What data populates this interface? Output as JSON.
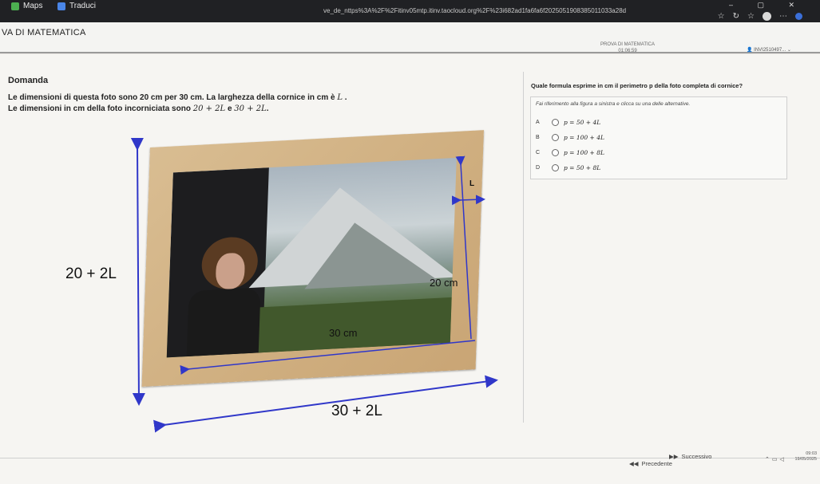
{
  "browser": {
    "bookmarks": [
      {
        "label": "Maps",
        "icon": "maps-icon"
      },
      {
        "label": "Traduci",
        "icon": "translate-icon"
      }
    ],
    "url": "ve_de_nttps%3A%2F%2Fitinv05mtp.itinv.taocloud.org%2F%23i682ad1fa6fa6f2025051908385011033a28d",
    "window_controls": "–  ▢  ✕"
  },
  "app": {
    "title": "VA DI MATEMATICA",
    "exam_name": "PROVA DI MATEMATICA",
    "timer": "01:06:59",
    "user": "INVI2510497..."
  },
  "question": {
    "section_label": "Domanda",
    "line1": "Le dimensioni di questa foto sono 20 cm per 30 cm. La larghezza della cornice in cm è",
    "line1_var": "L",
    "line2_prefix": "Le dimensioni in cm della foto incorniciata sono",
    "dim1": "20 + 2L",
    "conj": "e",
    "dim2": "30 + 2L",
    "figure_labels": {
      "height_outer": "20 + 2L",
      "width_outer": "30 + 2L",
      "height_inner": "20 cm",
      "width_inner": "30 cm",
      "frame_width": "L"
    }
  },
  "answer": {
    "prompt": "Quale formula esprime in cm il perimetro p della foto completa di cornice?",
    "hint": "Fai riferimento alla figura a sinistra e clicca su una delle alternative.",
    "options": [
      {
        "key": "A",
        "formula": "p = 50 + 4L"
      },
      {
        "key": "B",
        "formula": "p = 100 + 4L"
      },
      {
        "key": "C",
        "formula": "p = 100 + 8L"
      },
      {
        "key": "D",
        "formula": "p = 50 + 8L"
      }
    ]
  },
  "nav": {
    "prev_label": "Precedente",
    "next_label": "Successivo"
  },
  "taskbar": {
    "time": "09:03",
    "date": "19/05/2025"
  },
  "colors": {
    "accent_arrow": "#3037c9",
    "frame_wood": "#d4b688"
  }
}
